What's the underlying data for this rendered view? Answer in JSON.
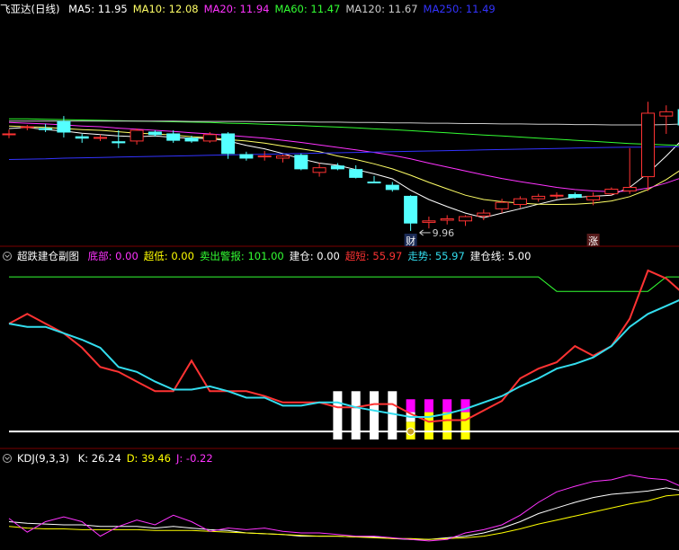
{
  "main_header": {
    "title": "飞亚达(日线)",
    "items": [
      {
        "label": "MA5: 11.95",
        "color": "#ffffff"
      },
      {
        "label": "MA10: 12.08",
        "color": "#ffff66"
      },
      {
        "label": "MA20: 11.94",
        "color": "#ff33ff"
      },
      {
        "label": "MA60: 11.47",
        "color": "#33ff33"
      },
      {
        "label": "MA120: 11.67",
        "color": "#cccccc"
      },
      {
        "label": "MA250: 11.49",
        "color": "#3333ff"
      }
    ]
  },
  "sub_header": {
    "title": "超跌建仓副图",
    "items": [
      {
        "name": "底部:",
        "value": "0.00",
        "color": "#ff33ff"
      },
      {
        "name": "超低:",
        "value": "0.00",
        "color": "#ffff00"
      },
      {
        "name": "卖出警报:",
        "value": "101.00",
        "color": "#33ff33"
      },
      {
        "name": "建仓:",
        "value": "0.00",
        "color": "#ffffff"
      },
      {
        "name": "超短:",
        "value": "55.97",
        "color": "#ff3333"
      },
      {
        "name": "走势:",
        "value": "55.97",
        "color": "#33ddee"
      },
      {
        "name": "建仓线:",
        "value": "5.00",
        "color": "#ffffff"
      }
    ]
  },
  "kdj_header": {
    "title": "KDJ(9,3,3)",
    "items": [
      {
        "name": "K:",
        "value": "26.24",
        "color": "#ffffff"
      },
      {
        "name": "D:",
        "value": "39.46",
        "color": "#ffff00"
      },
      {
        "name": "J:",
        "value": "-0.22",
        "color": "#ff33ff"
      }
    ]
  },
  "annotations": {
    "low_price": "9.96",
    "tag_left": "财",
    "tag_right": "涨"
  },
  "chart_data": [
    {
      "type": "candlestick",
      "panel": "main",
      "ylim": [
        9.2,
        15.6
      ],
      "candles": [
        {
          "o": 12.3,
          "h": 12.42,
          "l": 12.18,
          "c": 12.28,
          "up": true
        },
        {
          "o": 12.5,
          "h": 12.55,
          "l": 12.4,
          "c": 12.48,
          "up": true
        },
        {
          "o": 12.45,
          "h": 12.58,
          "l": 12.35,
          "c": 12.42,
          "up": false
        },
        {
          "o": 12.65,
          "h": 12.8,
          "l": 12.2,
          "c": 12.35,
          "up": false
        },
        {
          "o": 12.22,
          "h": 12.3,
          "l": 12.05,
          "c": 12.18,
          "up": false
        },
        {
          "o": 12.2,
          "h": 12.28,
          "l": 12.1,
          "c": 12.2,
          "up": true
        },
        {
          "o": 12.05,
          "h": 12.4,
          "l": 11.9,
          "c": 12.08,
          "up": false
        },
        {
          "o": 12.1,
          "h": 12.45,
          "l": 12.0,
          "c": 12.4,
          "up": true
        },
        {
          "o": 12.35,
          "h": 12.4,
          "l": 12.22,
          "c": 12.28,
          "up": false
        },
        {
          "o": 12.3,
          "h": 12.4,
          "l": 12.05,
          "c": 12.12,
          "up": false
        },
        {
          "o": 12.18,
          "h": 12.25,
          "l": 12.05,
          "c": 12.1,
          "up": false
        },
        {
          "o": 12.1,
          "h": 12.35,
          "l": 12.05,
          "c": 12.28,
          "up": true
        },
        {
          "o": 12.3,
          "h": 12.35,
          "l": 11.6,
          "c": 11.75,
          "up": false
        },
        {
          "o": 11.72,
          "h": 11.8,
          "l": 11.55,
          "c": 11.62,
          "up": false
        },
        {
          "o": 11.68,
          "h": 11.82,
          "l": 11.55,
          "c": 11.68,
          "up": true
        },
        {
          "o": 11.62,
          "h": 11.72,
          "l": 11.5,
          "c": 11.68,
          "up": true
        },
        {
          "o": 11.7,
          "h": 11.75,
          "l": 11.28,
          "c": 11.32,
          "up": false
        },
        {
          "o": 11.22,
          "h": 11.48,
          "l": 11.1,
          "c": 11.35,
          "up": true
        },
        {
          "o": 11.4,
          "h": 11.48,
          "l": 11.28,
          "c": 11.32,
          "up": false
        },
        {
          "o": 11.3,
          "h": 11.42,
          "l": 11.05,
          "c": 11.08,
          "up": false
        },
        {
          "o": 10.95,
          "h": 11.12,
          "l": 10.92,
          "c": 10.95,
          "up": false
        },
        {
          "o": 10.86,
          "h": 10.95,
          "l": 10.68,
          "c": 10.74,
          "up": false
        },
        {
          "o": 10.55,
          "h": 10.58,
          "l": 9.58,
          "c": 9.8,
          "up": false
        },
        {
          "o": 9.82,
          "h": 9.98,
          "l": 9.65,
          "c": 9.86,
          "up": true
        },
        {
          "o": 9.88,
          "h": 10.02,
          "l": 9.76,
          "c": 9.92,
          "up": true
        },
        {
          "o": 9.86,
          "h": 10.02,
          "l": 9.72,
          "c": 9.98,
          "up": true
        },
        {
          "o": 10.0,
          "h": 10.18,
          "l": 9.88,
          "c": 10.08,
          "up": true
        },
        {
          "o": 10.2,
          "h": 10.48,
          "l": 10.08,
          "c": 10.38,
          "up": true
        },
        {
          "o": 10.32,
          "h": 10.55,
          "l": 10.22,
          "c": 10.48,
          "up": true
        },
        {
          "o": 10.48,
          "h": 10.62,
          "l": 10.4,
          "c": 10.55,
          "up": true
        },
        {
          "o": 10.56,
          "h": 10.66,
          "l": 10.48,
          "c": 10.58,
          "up": true
        },
        {
          "o": 10.6,
          "h": 10.66,
          "l": 10.48,
          "c": 10.52,
          "up": false
        },
        {
          "o": 10.45,
          "h": 10.66,
          "l": 10.3,
          "c": 10.55,
          "up": true
        },
        {
          "o": 10.62,
          "h": 10.8,
          "l": 10.58,
          "c": 10.75,
          "up": true
        },
        {
          "o": 10.7,
          "h": 11.9,
          "l": 10.62,
          "c": 10.8,
          "up": true
        },
        {
          "o": 11.1,
          "h": 13.2,
          "l": 10.7,
          "c": 12.88,
          "up": true
        },
        {
          "o": 12.8,
          "h": 13.1,
          "l": 12.3,
          "c": 12.92,
          "up": true
        },
        {
          "o": 12.55,
          "h": 13.05,
          "l": 12.4,
          "c": 12.98,
          "up": false
        },
        {
          "o": 13.18,
          "h": 14.4,
          "l": 12.2,
          "c": 13.8,
          "up": true
        },
        {
          "o": 13.8,
          "h": 14.45,
          "l": 12.9,
          "c": 14.02,
          "up": true
        }
      ],
      "ma_series": [
        {
          "name": "MA5",
          "color": "#ffffff",
          "values": [
            12.45,
            12.48,
            12.42,
            12.38,
            12.32,
            12.28,
            12.24,
            12.22,
            12.24,
            12.2,
            12.18,
            12.17,
            12.1,
            11.98,
            11.88,
            11.75,
            11.6,
            11.48,
            11.42,
            11.3,
            11.18,
            11.04,
            10.72,
            10.46,
            10.26,
            10.08,
            9.95,
            10.08,
            10.2,
            10.33,
            10.45,
            10.52,
            10.55,
            10.58,
            10.8,
            11.2,
            11.68,
            12.2,
            12.78,
            13.3
          ]
        },
        {
          "name": "MA10",
          "color": "#ffff66",
          "values": [
            12.52,
            12.5,
            12.48,
            12.45,
            12.42,
            12.4,
            12.36,
            12.32,
            12.3,
            12.27,
            12.22,
            12.19,
            12.14,
            12.1,
            12.04,
            11.96,
            11.88,
            11.8,
            11.68,
            11.58,
            11.46,
            11.32,
            11.14,
            10.94,
            10.76,
            10.58,
            10.46,
            10.4,
            10.36,
            10.33,
            10.32,
            10.33,
            10.36,
            10.42,
            10.54,
            10.74,
            11.02,
            11.36,
            11.72,
            12.06
          ]
        },
        {
          "name": "MA20",
          "color": "#ff33ff",
          "values": [
            12.62,
            12.6,
            12.58,
            12.55,
            12.52,
            12.5,
            12.46,
            12.43,
            12.4,
            12.37,
            12.33,
            12.3,
            12.26,
            12.22,
            12.18,
            12.12,
            12.06,
            11.99,
            11.92,
            11.85,
            11.78,
            11.7,
            11.6,
            11.48,
            11.37,
            11.26,
            11.15,
            11.05,
            10.96,
            10.88,
            10.8,
            10.74,
            10.7,
            10.68,
            10.7,
            10.78,
            10.92,
            11.1,
            11.32,
            11.55
          ]
        },
        {
          "name": "MA60",
          "color": "#33ff33",
          "values": [
            12.72,
            12.72,
            12.71,
            12.7,
            12.69,
            12.68,
            12.67,
            12.66,
            12.65,
            12.64,
            12.63,
            12.62,
            12.6,
            12.59,
            12.57,
            12.55,
            12.53,
            12.51,
            12.49,
            12.47,
            12.44,
            12.42,
            12.39,
            12.36,
            12.33,
            12.3,
            12.27,
            12.24,
            12.21,
            12.18,
            12.15,
            12.12,
            12.09,
            12.06,
            12.03,
            12.01,
            11.99,
            11.98,
            11.98,
            11.99
          ]
        },
        {
          "name": "MA120",
          "color": "#cccccc",
          "values": [
            12.66,
            12.66,
            12.66,
            12.66,
            12.66,
            12.66,
            12.66,
            12.66,
            12.66,
            12.66,
            12.65,
            12.65,
            12.65,
            12.65,
            12.64,
            12.64,
            12.64,
            12.63,
            12.63,
            12.62,
            12.62,
            12.61,
            12.61,
            12.6,
            12.6,
            12.59,
            12.59,
            12.58,
            12.58,
            12.57,
            12.57,
            12.56,
            12.56,
            12.55,
            12.55,
            12.55,
            12.56,
            12.58,
            12.6,
            12.62
          ]
        },
        {
          "name": "MA250",
          "color": "#3333ff",
          "values": [
            11.58,
            11.59,
            11.6,
            11.62,
            11.63,
            11.64,
            11.65,
            11.66,
            11.67,
            11.68,
            11.69,
            11.7,
            11.71,
            11.72,
            11.73,
            11.74,
            11.75,
            11.76,
            11.77,
            11.78,
            11.79,
            11.8,
            11.81,
            11.82,
            11.83,
            11.84,
            11.85,
            11.86,
            11.87,
            11.88,
            11.89,
            11.9,
            11.91,
            11.92,
            11.93,
            11.93,
            11.94,
            11.94,
            11.95,
            11.95
          ]
        }
      ]
    },
    {
      "type": "line",
      "panel": "sub",
      "ylim": [
        -5,
        110
      ],
      "series": [
        {
          "name": "卖出警报",
          "color": "#33ff33",
          "values": [
            101,
            101,
            101,
            101,
            101,
            101,
            101,
            101,
            101,
            101,
            101,
            101,
            101,
            101,
            101,
            101,
            101,
            101,
            101,
            101,
            101,
            101,
            101,
            101,
            101,
            101,
            101,
            101,
            101,
            101,
            92,
            92,
            92,
            92,
            92,
            92,
            101,
            101,
            101,
            101
          ]
        },
        {
          "name": "超短",
          "color": "#ff3333",
          "values": [
            72,
            78,
            72,
            66,
            57,
            45,
            42,
            36,
            30,
            30,
            49,
            30,
            30,
            30,
            27,
            23,
            23,
            23,
            20,
            20,
            22,
            22,
            16,
            11,
            12,
            12,
            18,
            24,
            38,
            44,
            48,
            58,
            52,
            58,
            75,
            105,
            100,
            90,
            95,
            92
          ]
        },
        {
          "name": "走势",
          "color": "#33ddee",
          "values": [
            72,
            70,
            70,
            66,
            62,
            57,
            45,
            42,
            36,
            31,
            31,
            33,
            30,
            26,
            26,
            21,
            21,
            23,
            23,
            20,
            18,
            16,
            14,
            14,
            16,
            19,
            23,
            27,
            33,
            38,
            44,
            47,
            51,
            58,
            70,
            78,
            83,
            88,
            90,
            92
          ]
        },
        {
          "name": "建仓线",
          "color": "#ffffff",
          "values": [
            5,
            5,
            5,
            5,
            5,
            5,
            5,
            5,
            5,
            5,
            5,
            5,
            5,
            5,
            5,
            5,
            5,
            5,
            5,
            5,
            5,
            5,
            5,
            5,
            5,
            5,
            5,
            5,
            5,
            5,
            5,
            5,
            5,
            5,
            5,
            5,
            5,
            5,
            5,
            5
          ]
        }
      ],
      "bars": [
        {
          "index": 18,
          "values": {
            "white": 30
          }
        },
        {
          "index": 19,
          "values": {
            "white": 30
          }
        },
        {
          "index": 20,
          "values": {
            "white": 30
          }
        },
        {
          "index": 21,
          "values": {
            "white": 30
          }
        },
        {
          "index": 22,
          "values": {
            "yellow": 11,
            "white": 6,
            "magenta": 8
          }
        },
        {
          "index": 23,
          "values": {
            "yellow": 17,
            "magenta": 8
          }
        },
        {
          "index": 24,
          "values": {
            "yellow": 17,
            "magenta": 8
          }
        },
        {
          "index": 25,
          "values": {
            "yellow": 17,
            "magenta": 8
          }
        }
      ]
    },
    {
      "type": "line",
      "panel": "kdj",
      "ylim": [
        -5,
        100
      ],
      "series": [
        {
          "name": "K",
          "color": "#ffffff",
          "values": [
            28,
            26,
            25,
            24,
            24,
            22,
            22,
            22,
            20,
            22,
            20,
            18,
            17,
            14,
            13,
            12,
            10,
            10,
            10,
            9,
            9,
            7,
            6,
            6,
            8,
            10,
            14,
            20,
            28,
            38,
            45,
            52,
            58,
            62,
            64,
            66,
            70,
            66,
            64,
            64
          ]
        },
        {
          "name": "D",
          "color": "#ffff00",
          "values": [
            22,
            20,
            19,
            19,
            18,
            18,
            18,
            18,
            17,
            17,
            17,
            16,
            15,
            14,
            13,
            12,
            11,
            10,
            10,
            9,
            8,
            7,
            7,
            6,
            7,
            8,
            10,
            14,
            19,
            25,
            30,
            35,
            40,
            45,
            50,
            54,
            60,
            62,
            63,
            63
          ]
        },
        {
          "name": "J",
          "color": "#ff33ff",
          "values": [
            32,
            15,
            28,
            34,
            28,
            10,
            22,
            30,
            24,
            36,
            28,
            16,
            20,
            18,
            20,
            16,
            14,
            14,
            12,
            10,
            10,
            8,
            6,
            4,
            6,
            14,
            18,
            24,
            36,
            52,
            65,
            72,
            78,
            80,
            86,
            82,
            80,
            70,
            66,
            66
          ]
        }
      ]
    }
  ]
}
